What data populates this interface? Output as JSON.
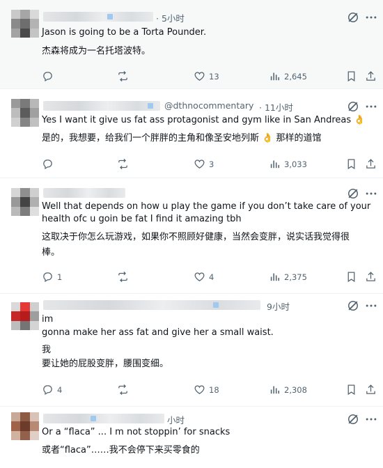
{
  "posts": [
    {
      "handle": "",
      "time": "· 5小时",
      "lines": [
        "Jason is going to be a Torta Pounder."
      ],
      "translation": [
        "杰森将成为一名托塔波特。"
      ],
      "replies": "",
      "likes": "13",
      "views": "2,645"
    },
    {
      "handle": "@dthnocommentary",
      "time": "· 11小时",
      "lines": [
        "Yes I want it give us fat ass protagonist and gym like in San Andreas 👌"
      ],
      "translation": [
        "是的，我想要，给我们一个胖胖的主角和像圣安地列斯 👌 那样的道馆"
      ],
      "replies": "",
      "likes": "3",
      "views": "3,033"
    },
    {
      "handle": "",
      "time": "",
      "lines": [
        "Well that depends on how u play the game if you don’t take care of your",
        "health ofc u goin be fat I find it amazing tbh"
      ],
      "translation": [
        "这取决于你怎么玩游戏，如果你不照顾好健康，当然会变胖，说实话我觉得很",
        "棒。"
      ],
      "replies": "1",
      "likes": "4",
      "views": "2,375"
    },
    {
      "handle": "",
      "time": "9小时",
      "lines": [
        "im",
        "gonna make her ass fat and give her a small waist."
      ],
      "translation": [
        "我",
        "要让她的屁股变胖，腰围变细。"
      ],
      "replies": "4",
      "likes": "18",
      "views": "2,308"
    },
    {
      "handle": "",
      "time": "小时",
      "lines": [
        "Or a “flaca” ... I m not stoppin’ for snacks"
      ],
      "translation": [
        "或者“flaca”……我不会停下来买零食的"
      ]
    }
  ],
  "icons": {
    "reply": "reply-icon",
    "retweet": "retweet-icon",
    "like": "heart-icon",
    "views": "views-icon",
    "bookmark": "bookmark-icon",
    "share": "share-icon",
    "grok": "grok-icon"
  },
  "colors": {
    "text": "#0f1419",
    "secondary": "#536471",
    "highlight_bg": "#f7f9f9",
    "divider": "#eff3f4"
  }
}
